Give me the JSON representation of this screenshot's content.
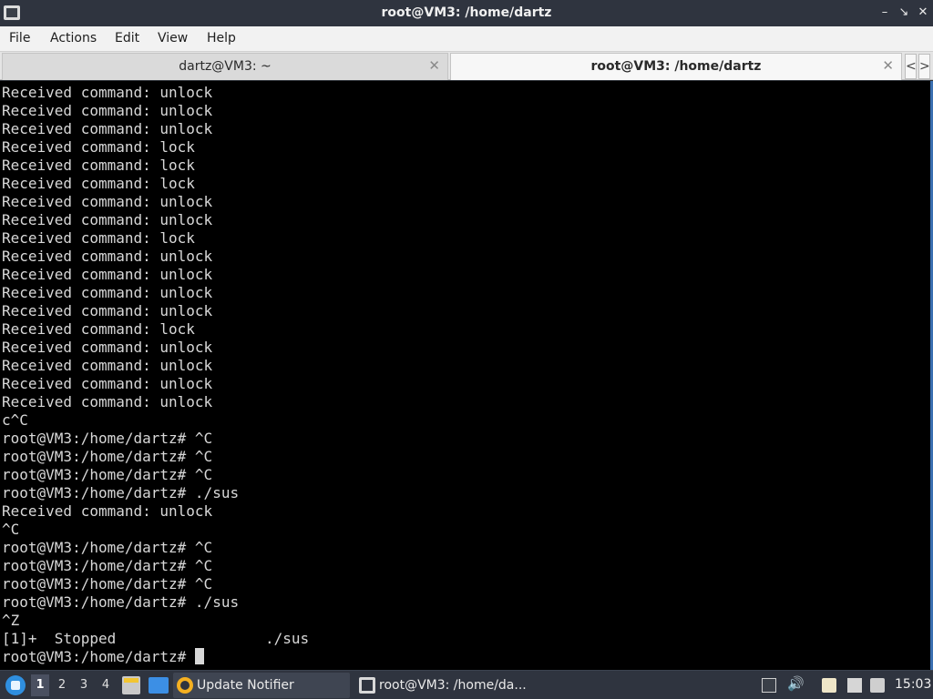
{
  "window": {
    "title": "root@VM3: /home/dartz",
    "buttons": {
      "minimize": "–",
      "maximize": "↘",
      "close": "✕"
    }
  },
  "menubar": {
    "items": [
      "File",
      "Actions",
      "Edit",
      "View",
      "Help"
    ]
  },
  "tabs": [
    {
      "label": "dartz@VM3: ~",
      "close": "✕",
      "active": false
    },
    {
      "label": "root@VM3: /home/dartz",
      "close": "✕",
      "active": true
    }
  ],
  "tab_scroll": {
    "left": "<",
    "right": ">"
  },
  "terminal": {
    "lines": [
      "Received command: unlock",
      "Received command: unlock",
      "Received command: unlock",
      "Received command: lock",
      "Received command: lock",
      "Received command: lock",
      "Received command: unlock",
      "Received command: unlock",
      "Received command: lock",
      "Received command: unlock",
      "Received command: unlock",
      "Received command: unlock",
      "Received command: unlock",
      "Received command: lock",
      "Received command: unlock",
      "Received command: unlock",
      "Received command: unlock",
      "Received command: unlock",
      "c^C",
      "root@VM3:/home/dartz# ^C",
      "root@VM3:/home/dartz# ^C",
      "root@VM3:/home/dartz# ^C",
      "root@VM3:/home/dartz# ./sus",
      "Received command: unlock",
      "^C",
      "root@VM3:/home/dartz# ^C",
      "root@VM3:/home/dartz# ^C",
      "root@VM3:/home/dartz# ^C",
      "root@VM3:/home/dartz# ./sus",
      "^Z",
      "[1]+  Stopped                 ./sus"
    ],
    "prompt": "root@VM3:/home/dartz# "
  },
  "taskbar": {
    "workspaces": [
      "1",
      "2",
      "3",
      "4"
    ],
    "current_workspace": "1",
    "tasks": [
      {
        "label": "Update Notifier",
        "icon": "update-notifier-icon"
      },
      {
        "label": "root@VM3: /home/da...",
        "icon": "terminal-icon"
      }
    ],
    "tray_icons": [
      "brightness-icon",
      "volume-icon",
      "clipboard-icon",
      "network-icon",
      "monitor-icon"
    ],
    "clock": "15:03"
  },
  "colors": {
    "titlebar_bg": "#2f343f",
    "terminal_bg": "#000000",
    "terminal_fg": "#d8d8d8",
    "accent": "#3a6fb0"
  }
}
